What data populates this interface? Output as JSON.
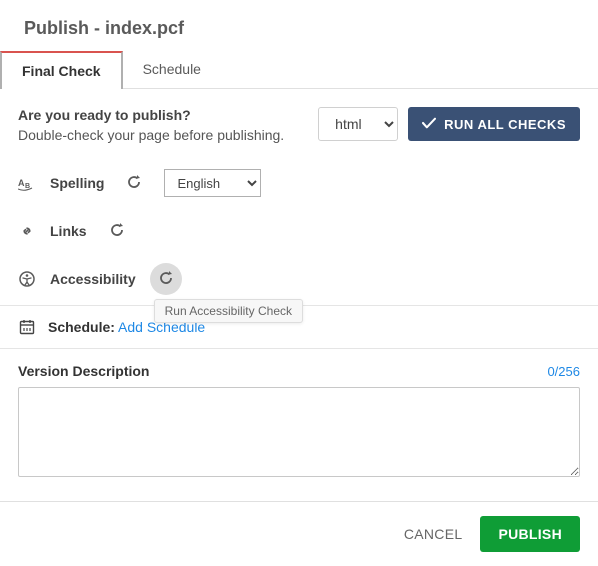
{
  "header": {
    "title": "Publish - index.pcf"
  },
  "tabs": {
    "final_check": "Final Check",
    "schedule": "Schedule"
  },
  "ready": {
    "question": "Are you ready to publish?",
    "subtext": "Double-check your page before publishing."
  },
  "format_select": {
    "selected": "html",
    "options": [
      "html"
    ]
  },
  "run_all_label": "RUN ALL CHECKS",
  "checks": {
    "spelling": "Spelling",
    "links": "Links",
    "accessibility": "Accessibility"
  },
  "language_select": {
    "selected": "English",
    "options": [
      "English"
    ]
  },
  "tooltip_accessibility": "Run Accessibility Check",
  "schedule_row": {
    "label": "Schedule:",
    "link": "Add Schedule"
  },
  "version": {
    "label": "Version Description",
    "counter": "0/256",
    "value": ""
  },
  "footer": {
    "cancel": "CANCEL",
    "publish": "PUBLISH"
  }
}
